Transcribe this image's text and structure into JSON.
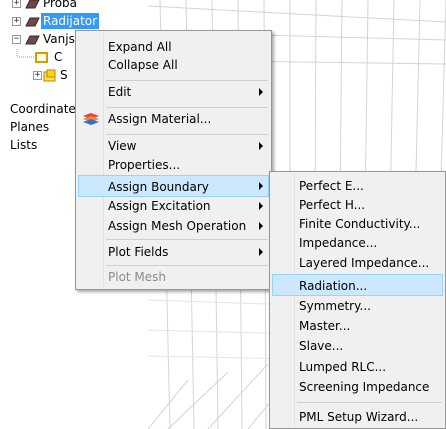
{
  "tree": {
    "nodes": [
      {
        "label": "Proba"
      },
      {
        "label": "Radijator"
      },
      {
        "label": "Vanjski"
      },
      {
        "label": "C"
      },
      {
        "label": "S"
      }
    ],
    "roots": [
      "Coordinate S",
      "Planes",
      "Lists"
    ]
  },
  "context_menu": {
    "items": [
      {
        "label": "Expand All"
      },
      {
        "label": "Collapse All"
      },
      {
        "label": "Edit"
      },
      {
        "label": "Assign Material..."
      },
      {
        "label": "View"
      },
      {
        "label": "Properties..."
      },
      {
        "label": "Assign Boundary"
      },
      {
        "label": "Assign Excitation"
      },
      {
        "label": "Assign Mesh Operation"
      },
      {
        "label": "Plot Fields"
      },
      {
        "label": "Plot Mesh"
      }
    ]
  },
  "submenu": {
    "items": [
      {
        "label": "Perfect E..."
      },
      {
        "label": "Perfect H..."
      },
      {
        "label": "Finite Conductivity..."
      },
      {
        "label": "Impedance..."
      },
      {
        "label": "Layered Impedance..."
      },
      {
        "label": "Radiation..."
      },
      {
        "label": "Symmetry..."
      },
      {
        "label": "Master..."
      },
      {
        "label": "Slave..."
      },
      {
        "label": "Lumped RLC..."
      },
      {
        "label": "Screening Impedance"
      },
      {
        "label": "PML Setup Wizard..."
      }
    ]
  },
  "colors": {
    "selection": "#3399ff",
    "menu_bg": "#f0f0f0",
    "menu_highlight": "#cce8ff",
    "menu_highlight_border": "#99d1ff"
  }
}
